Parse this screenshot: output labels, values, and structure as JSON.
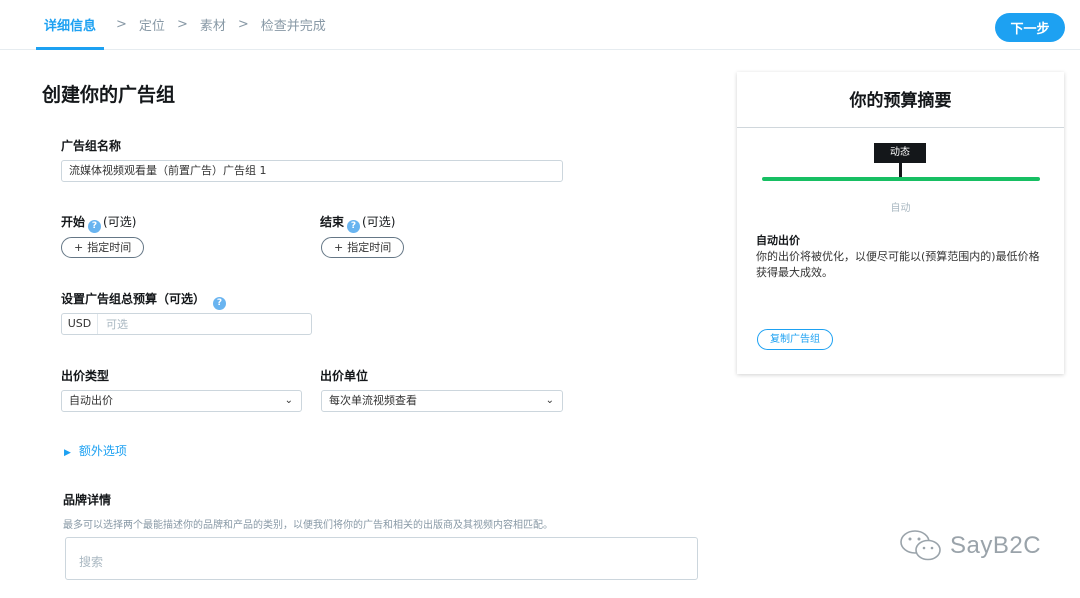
{
  "steps": [
    "详细信息",
    "定位",
    "素材",
    "检查并完成"
  ],
  "step_separator": ">",
  "next_button": "下一步",
  "page_title": "创建你的广告组",
  "ad_group_name": {
    "label": "广告组名称",
    "value": "流媒体视频观看量（前置广告）广告组 1"
  },
  "start": {
    "label": "开始",
    "optional": "(可选)",
    "button": "指定时间",
    "help": "?"
  },
  "end": {
    "label": "结束",
    "optional": "(可选)",
    "button": "指定时间",
    "help": "?"
  },
  "budget": {
    "label": "设置广告组总预算（可选）",
    "currency": "USD",
    "placeholder": "可选",
    "help": "?"
  },
  "bid_type": {
    "label": "出价类型",
    "value": "自动出价"
  },
  "bid_unit": {
    "label": "出价单位",
    "value": "每次单流视频查看"
  },
  "additional_options": "额外选项",
  "brand": {
    "label": "品牌详情",
    "description": "最多可以选择两个最能描述你的品牌和产品的类别，以便我们将你的广告和相关的出版商及其视频内容相匹配。",
    "search_placeholder": "搜索"
  },
  "summary": {
    "title": "你的预算摘要",
    "slider_tooltip": "动态",
    "slider_caption": "自动",
    "bid_title": "自动出价",
    "bid_description": "你的出价将被优化，以便尽可能以(预算范围内的)最低价格获得最大成效。",
    "copy_button": "复制广告组"
  },
  "watermark": "SayB2C",
  "colors": {
    "accent": "#1da1f2",
    "slider": "#17bf63",
    "tooltip": "#14171a"
  }
}
